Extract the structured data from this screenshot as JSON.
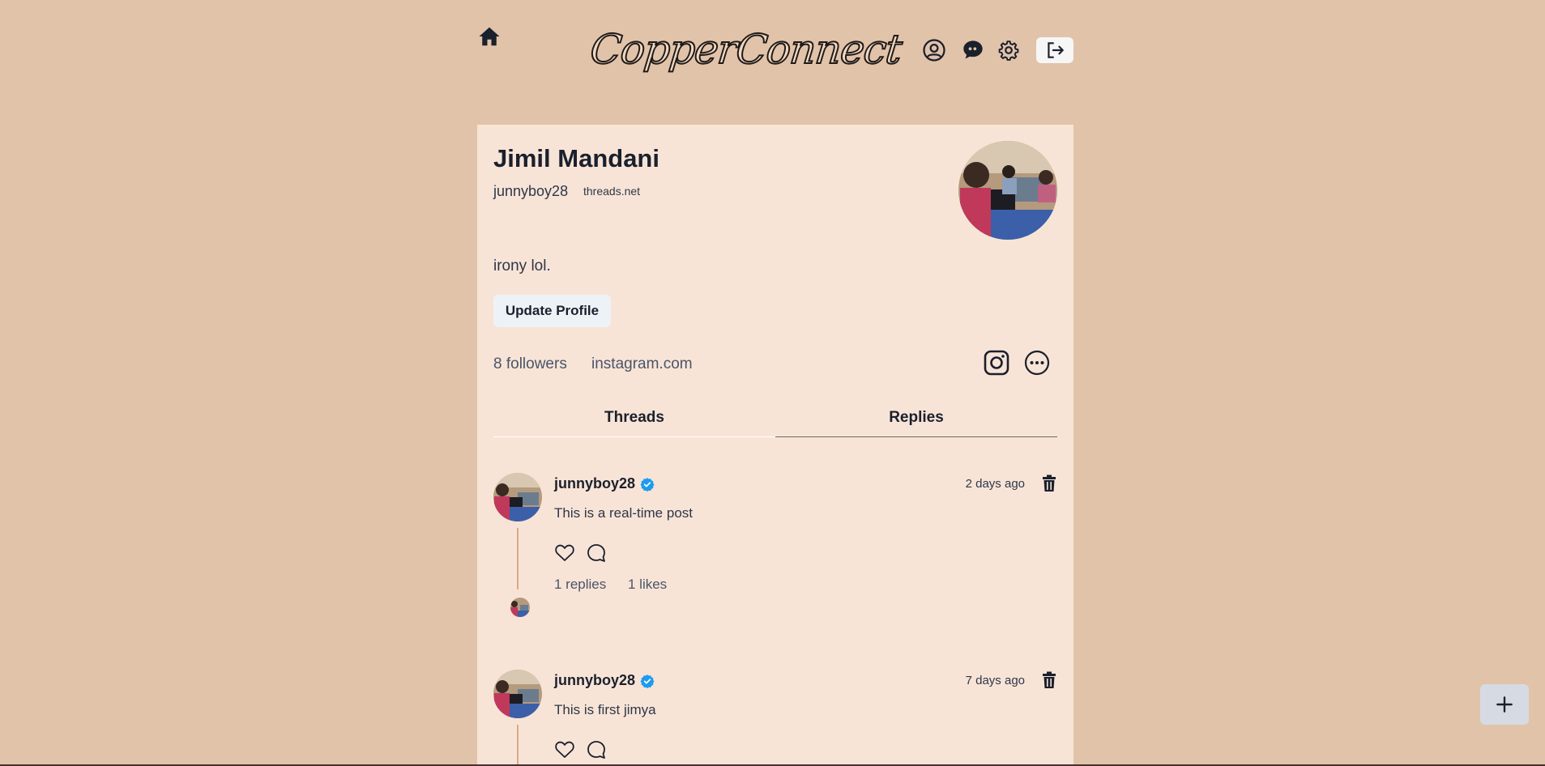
{
  "app": {
    "logo_text": "CopperConnect"
  },
  "header": {
    "icons": [
      "home-icon",
      "profile-icon",
      "chat-icon",
      "settings-icon",
      "logout-icon"
    ]
  },
  "profile": {
    "name": "Jimil Mandani",
    "username": "junnyboy28",
    "domain": "threads.net",
    "bio": "irony lol.",
    "update_button": "Update Profile",
    "followers": "8 followers",
    "link": "instagram.com"
  },
  "tabs": [
    {
      "label": "Threads"
    },
    {
      "label": "Replies"
    }
  ],
  "posts": [
    {
      "username": "junnyboy28",
      "time": "2 days ago",
      "text": "This is a real-time post",
      "replies": "1 replies",
      "likes": "1 likes"
    },
    {
      "username": "junnyboy28",
      "time": "7 days ago",
      "text": "This is first jimya"
    }
  ],
  "colors": {
    "background": "#e1c3a9",
    "card": "#f8e4d7",
    "verified": "#1d9bf0"
  }
}
